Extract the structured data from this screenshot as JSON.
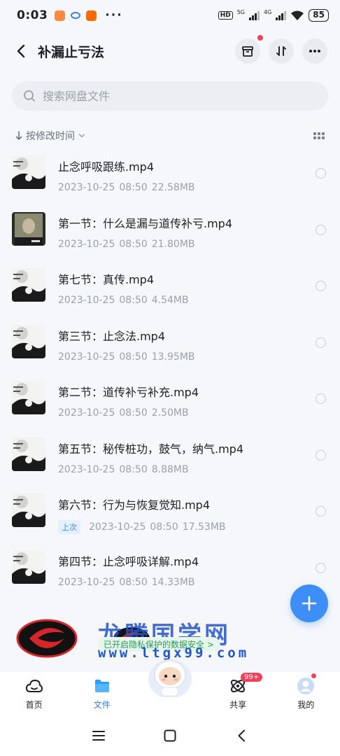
{
  "status_bar": {
    "time": "0:03",
    "network": "HD",
    "signal1": "5G",
    "signal2": "4G",
    "battery": "85"
  },
  "header": {
    "title": "补漏止亏法"
  },
  "search": {
    "placeholder": "搜索网盘文件"
  },
  "sort": {
    "label": "按修改时间"
  },
  "files": [
    {
      "name": "止念呼吸跟练.mp4",
      "date": "2023-10-25",
      "time": "08:50",
      "size": "22.58MB",
      "tag": ""
    },
    {
      "name": "第一节：什么是漏与道传补亏.mp4",
      "date": "2023-10-25",
      "time": "08:50",
      "size": "21.80MB",
      "tag": ""
    },
    {
      "name": "第七节：真传.mp4",
      "date": "2023-10-25",
      "time": "08:50",
      "size": "4.54MB",
      "tag": ""
    },
    {
      "name": "第三节：止念法.mp4",
      "date": "2023-10-25",
      "time": "08:50",
      "size": "13.95MB",
      "tag": ""
    },
    {
      "name": "第二节：道传补亏补充.mp4",
      "date": "2023-10-25",
      "time": "08:50",
      "size": "2.50MB",
      "tag": ""
    },
    {
      "name": "第五节：秘传桩功，鼓气，纳气.mp4",
      "date": "2023-10-25",
      "time": "08:50",
      "size": "8.88MB",
      "tag": ""
    },
    {
      "name": "第六节：行为与恢复觉知.mp4",
      "date": "2023-10-25",
      "time": "08:50",
      "size": "17.53MB",
      "tag": "上次"
    },
    {
      "name": "第四节：止念呼吸详解.mp4",
      "date": "2023-10-25",
      "time": "08:50",
      "size": "14.33MB",
      "tag": ""
    }
  ],
  "banner": {
    "watermark": "龙腾国学网",
    "url": "www.ltgx99.com",
    "tip": "已开启隐私保护的数据安全 >"
  },
  "tabs": [
    {
      "label": "首页",
      "icon": "cloud-icon"
    },
    {
      "label": "文件",
      "icon": "folder-icon"
    },
    {
      "label": "",
      "icon": "mascot-icon"
    },
    {
      "label": "共享",
      "icon": "share-icon",
      "badge": "99+"
    },
    {
      "label": "我的",
      "icon": "avatar-icon"
    }
  ],
  "colors": {
    "accent": "#2f7cf0",
    "badge": "#f0405b",
    "fab": "#3d8ef7"
  }
}
